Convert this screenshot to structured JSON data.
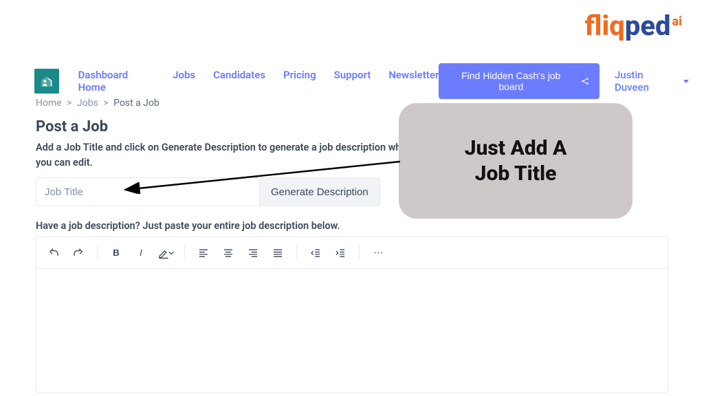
{
  "brand": {
    "part1": "fliq",
    "part2": "ped",
    "sup": "ai"
  },
  "nav": {
    "items": [
      {
        "label": "Dashboard Home"
      },
      {
        "label": "Jobs"
      },
      {
        "label": "Candidates"
      },
      {
        "label": "Pricing"
      },
      {
        "label": "Support"
      },
      {
        "label": "Newsletter"
      }
    ],
    "cta": "Find Hidden Cash's job board",
    "user": "Justin Duveen"
  },
  "breadcrumb": {
    "home": "Home",
    "jobs": "Jobs",
    "current": "Post a Job",
    "sep": ">"
  },
  "page": {
    "title": "Post a Job",
    "helper1": "Add a Job Title and click on Generate Description to generate a job description which you can edit.",
    "job_title_placeholder": "Job Title",
    "generate_btn": "Generate Description",
    "helper2": "Have a job description? Just paste your entire job description below."
  },
  "editor_toolbar": {
    "bold": "B",
    "italic": "I",
    "more": "⋯"
  },
  "callout": {
    "line1": "Just Add A",
    "line2": "Job Title"
  }
}
